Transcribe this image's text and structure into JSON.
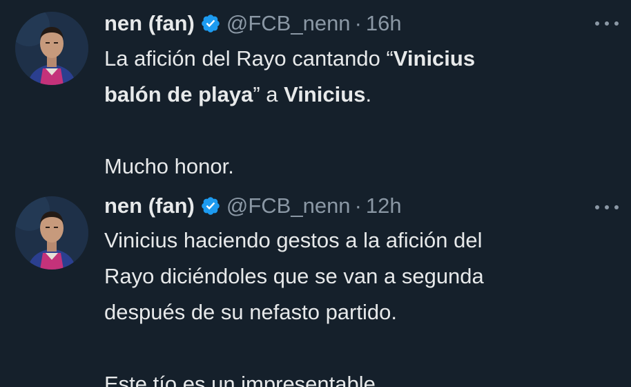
{
  "tweets": [
    {
      "display_name": "nen (fan)",
      "handle": "@FCB_nenn",
      "separator": "·",
      "time": "16h",
      "more_icon": "more-horizontal-icon",
      "verified_icon": "verified-badge-icon",
      "body": {
        "l1a": "La afición del Rayo cantando “",
        "l1b": "Vinicius",
        "l2a": "balón de playa",
        "l2b": "” a ",
        "l2c": "Vinicius",
        "l2d": ".",
        "l3": "Mucho honor."
      }
    },
    {
      "display_name": "nen (fan)",
      "handle": "@FCB_nenn",
      "separator": "·",
      "time": "12h",
      "more_icon": "more-horizontal-icon",
      "verified_icon": "verified-badge-icon",
      "body": {
        "l1": "Vinicius haciendo gestos a la afición del",
        "l2": "Rayo diciéndoles que se van a segunda",
        "l3": "después de su nefasto partido.",
        "l4": "Este tío es un impresentable."
      }
    }
  ],
  "colors": {
    "background": "#15202b",
    "text": "#e7e9ea",
    "muted": "#8b98a5",
    "verified": "#1d9bf0"
  }
}
